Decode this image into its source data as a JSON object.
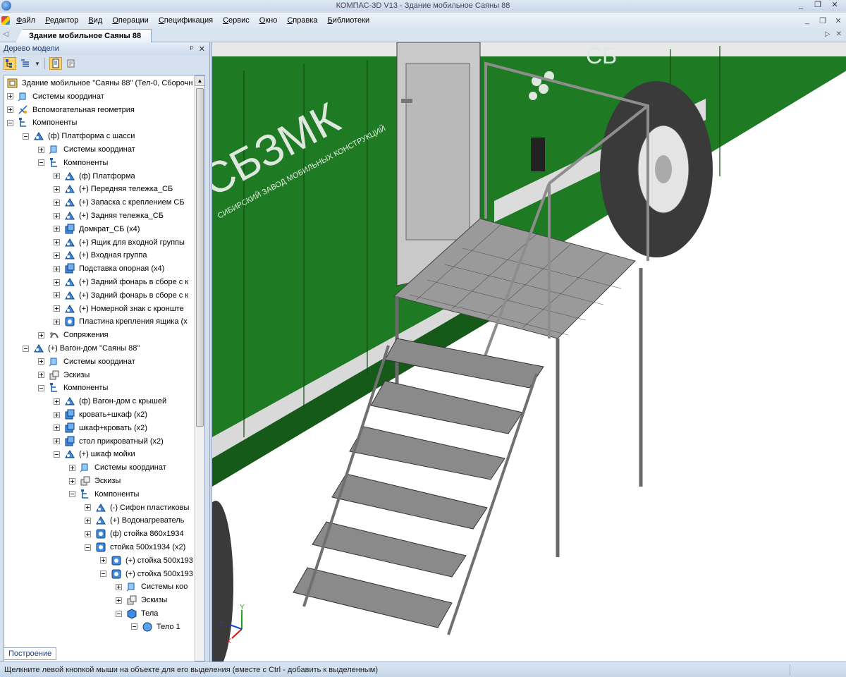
{
  "window": {
    "title": "КОМПАС-3D V13 - Здание мобильное Саяны 88",
    "minimize": "_",
    "restore": "❐",
    "close": "✕"
  },
  "menu": {
    "items": [
      "Файл",
      "Редактор",
      "Вид",
      "Операции",
      "Спецификация",
      "Сервис",
      "Окно",
      "Справка",
      "Библиотеки"
    ],
    "right": [
      "_",
      "❐",
      "✕"
    ]
  },
  "doc_tab": {
    "label": "Здание мобильное Саяны 88",
    "left_arrow": "◁",
    "right_controls": [
      "▷",
      "✕"
    ]
  },
  "panel": {
    "title": "Дерево модели",
    "pin": "ᵖ",
    "close": "✕",
    "bottom_tab": "Построение"
  },
  "tree": [
    {
      "depth": 0,
      "expander": "none",
      "icon": "assembly-root",
      "label": "Здание мобильное \"Саяны 88\" (Тел-0, Сборочн"
    },
    {
      "depth": 0,
      "expander": "plus",
      "icon": "coord-system",
      "label": "Системы координат"
    },
    {
      "depth": 0,
      "expander": "plus",
      "icon": "aux-geometry",
      "label": "Вспомогательная геометрия"
    },
    {
      "depth": 0,
      "expander": "minus",
      "icon": "components",
      "label": "Компоненты"
    },
    {
      "depth": 1,
      "expander": "minus",
      "icon": "subassembly",
      "label": "(ф) Платформа с шасси"
    },
    {
      "depth": 2,
      "expander": "plus",
      "icon": "coord-system",
      "label": "Системы координат"
    },
    {
      "depth": 2,
      "expander": "minus",
      "icon": "components",
      "label": "Компоненты"
    },
    {
      "depth": 3,
      "expander": "plus",
      "icon": "subassembly",
      "label": "(ф) Платформа"
    },
    {
      "depth": 3,
      "expander": "plus",
      "icon": "subassembly",
      "label": "(+) Передняя тележка_СБ"
    },
    {
      "depth": 3,
      "expander": "plus",
      "icon": "subassembly",
      "label": "(+) Запаска с креплением СБ"
    },
    {
      "depth": 3,
      "expander": "plus",
      "icon": "subassembly",
      "label": "(+) Задняя тележка_СБ"
    },
    {
      "depth": 3,
      "expander": "plus",
      "icon": "part-multi",
      "label": "Домкрат_СБ (x4)"
    },
    {
      "depth": 3,
      "expander": "plus",
      "icon": "subassembly",
      "label": "(+) Ящик для входной группы"
    },
    {
      "depth": 3,
      "expander": "plus",
      "icon": "subassembly",
      "label": "(+) Входная группа"
    },
    {
      "depth": 3,
      "expander": "plus",
      "icon": "part-multi",
      "label": "Подставка опорная (x4)"
    },
    {
      "depth": 3,
      "expander": "plus",
      "icon": "subassembly",
      "label": "(+) Задний фонарь в сборе с к"
    },
    {
      "depth": 3,
      "expander": "plus",
      "icon": "subassembly",
      "label": "(+) Задний фонарь в сборе с к"
    },
    {
      "depth": 3,
      "expander": "plus",
      "icon": "subassembly",
      "label": "(+) Номерной знак с кронште"
    },
    {
      "depth": 3,
      "expander": "plus",
      "icon": "part",
      "label": "Пластина крепления ящика (x"
    },
    {
      "depth": 2,
      "expander": "plus",
      "icon": "mates",
      "label": "Сопряжения"
    },
    {
      "depth": 1,
      "expander": "minus",
      "icon": "subassembly",
      "label": "(+) Вагон-дом \"Саяны 88\""
    },
    {
      "depth": 2,
      "expander": "plus",
      "icon": "coord-system",
      "label": "Системы координат"
    },
    {
      "depth": 2,
      "expander": "plus",
      "icon": "sketches",
      "label": "Эскизы"
    },
    {
      "depth": 2,
      "expander": "minus",
      "icon": "components",
      "label": "Компоненты"
    },
    {
      "depth": 3,
      "expander": "plus",
      "icon": "subassembly",
      "label": "(ф) Вагон-дом с крышей"
    },
    {
      "depth": 3,
      "expander": "plus",
      "icon": "part-multi",
      "label": "кровать+шкаф (x2)"
    },
    {
      "depth": 3,
      "expander": "plus",
      "icon": "part-multi",
      "label": "шкаф+кровать (x2)"
    },
    {
      "depth": 3,
      "expander": "plus",
      "icon": "part-multi",
      "label": "стол прикроватный (x2)"
    },
    {
      "depth": 3,
      "expander": "minus",
      "icon": "subassembly",
      "label": "(+) шкаф мойки"
    },
    {
      "depth": 4,
      "expander": "plus",
      "icon": "coord-system",
      "label": "Системы координат"
    },
    {
      "depth": 4,
      "expander": "plus",
      "icon": "sketches",
      "label": "Эскизы"
    },
    {
      "depth": 4,
      "expander": "minus",
      "icon": "components",
      "label": "Компоненты"
    },
    {
      "depth": 5,
      "expander": "plus",
      "icon": "subassembly",
      "label": "(-) Сифон пластиковы"
    },
    {
      "depth": 5,
      "expander": "plus",
      "icon": "subassembly",
      "label": "(+) Водонагреватель"
    },
    {
      "depth": 5,
      "expander": "plus",
      "icon": "part",
      "label": "(ф) стойка 860x1934"
    },
    {
      "depth": 5,
      "expander": "minus",
      "icon": "part",
      "label": "стойка 500x1934 (x2)"
    },
    {
      "depth": 6,
      "expander": "plus",
      "icon": "part",
      "label": "(+) стойка 500x193"
    },
    {
      "depth": 6,
      "expander": "minus",
      "icon": "part",
      "label": "(+) стойка 500x193"
    },
    {
      "depth": 7,
      "expander": "plus",
      "icon": "coord-system",
      "label": "Системы коо"
    },
    {
      "depth": 7,
      "expander": "plus",
      "icon": "sketches",
      "label": "Эскизы"
    },
    {
      "depth": 7,
      "expander": "minus",
      "icon": "bodies",
      "label": "Тела"
    },
    {
      "depth": 8,
      "expander": "minus",
      "icon": "body",
      "label": "Тело 1"
    }
  ],
  "viewport": {
    "brand_text": "СБЗМК",
    "brand_sub": "СИБИРСКИЙ ЗАВОД МОБИЛЬНЫХ КОНСТРУКЦИЙ",
    "brand_right": "СБ",
    "axis_y": "Y",
    "axis_z": "Z",
    "axis_x": "X",
    "colors": {
      "trailer_green": "#1f7a24",
      "trailer_dark": "#155a18",
      "steel": "#b8b8b8",
      "tread": "#7a7a7a"
    }
  },
  "status": {
    "text": "Щелкните левой кнопкой мыши на объекте для его выделения (вместе с Ctrl - добавить к выделенным)"
  }
}
